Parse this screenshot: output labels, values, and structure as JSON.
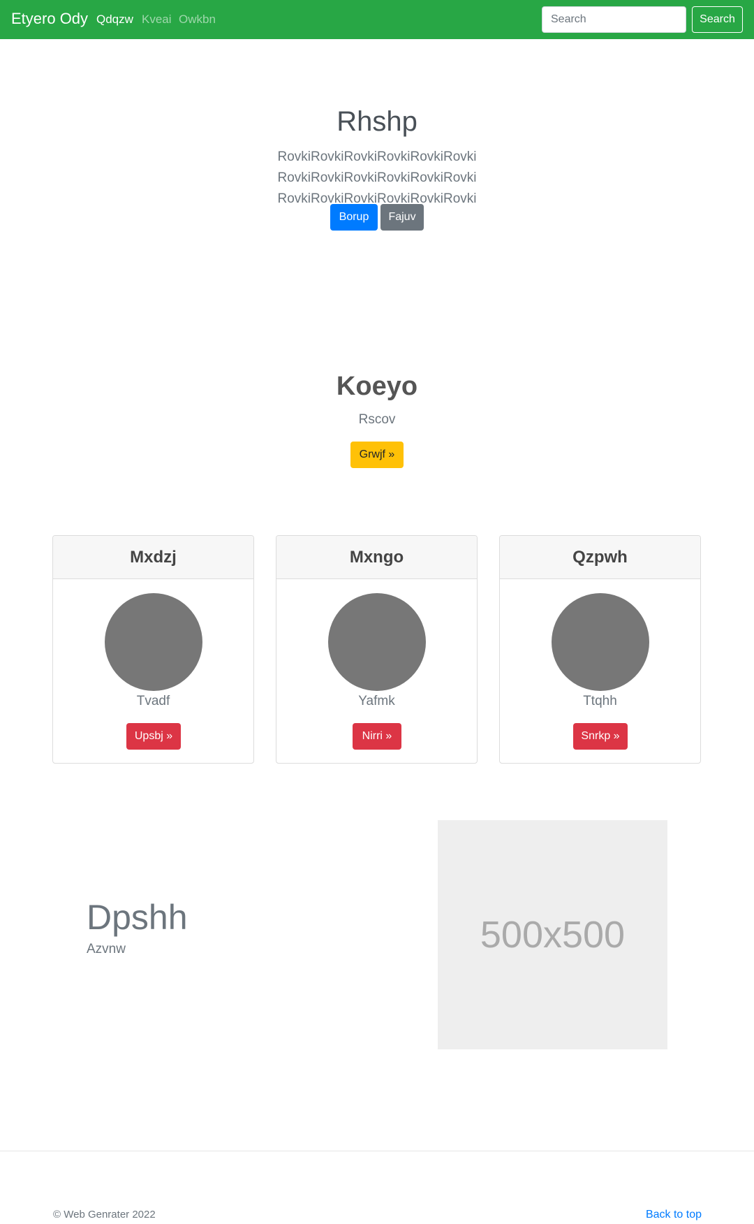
{
  "navbar": {
    "brand": "Etyero Ody",
    "links": [
      {
        "label": "Qdqzw"
      },
      {
        "label": "Kveai"
      },
      {
        "label": "Owkbn"
      }
    ],
    "search": {
      "placeholder": "Search",
      "button_label": "Search"
    }
  },
  "hero": {
    "title": "Rhshp",
    "text": "RovkiRovkiRovkiRovkiRovkiRovki RovkiRovkiRovkiRovkiRovkiRovki RovkiRovkiRovkiRovkiRovkiRovki",
    "primary_button": "Borup",
    "secondary_button": "Fajuv"
  },
  "feature": {
    "title": "Koeyo",
    "subtitle": "Rscov",
    "button": "Grwjf »"
  },
  "cards": [
    {
      "title": "Mxdzj",
      "label": "Tvadf",
      "button": "Upsbj »"
    },
    {
      "title": "Mxngo",
      "label": "Yafmk",
      "button": "Nirri »"
    },
    {
      "title": "Qzpwh",
      "label": "Ttqhh",
      "button": "Snrkp »"
    }
  ],
  "split": {
    "title": "Dpshh",
    "subtitle": "Azvnw",
    "image_text": "500x500"
  },
  "footer": {
    "copyright": "© Web Genrater 2022",
    "back_to_top": "Back to top"
  },
  "colors": {
    "navbar": "#28a745",
    "primary": "#007bff",
    "secondary": "#6c757d",
    "warning": "#ffc107",
    "danger": "#dc3545"
  }
}
